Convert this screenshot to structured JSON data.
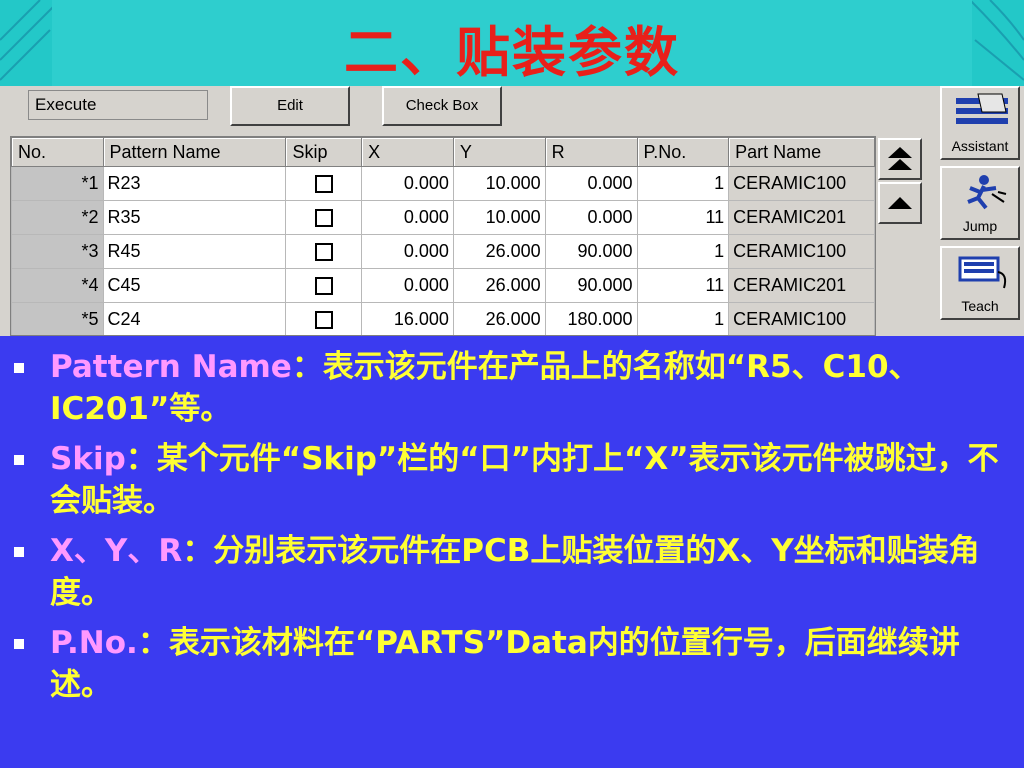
{
  "slide_title": "二、贴装参数",
  "toolbar": {
    "execute_label": "Execute",
    "edit_label": "Edit",
    "check_box_label": "Check Box"
  },
  "table": {
    "columns": [
      "No.",
      "Pattern Name",
      "Skip",
      "X",
      "Y",
      "R",
      "P.No.",
      "Part Name"
    ],
    "rows": [
      {
        "no": "*1",
        "pattern": "R23",
        "x": "0.000",
        "y": "10.000",
        "r": "0.000",
        "pno": "1",
        "part": "CERAMIC100"
      },
      {
        "no": "*2",
        "pattern": "R35",
        "x": "0.000",
        "y": "10.000",
        "r": "0.000",
        "pno": "11",
        "part": "CERAMIC201"
      },
      {
        "no": "*3",
        "pattern": "R45",
        "x": "0.000",
        "y": "26.000",
        "r": "90.000",
        "pno": "1",
        "part": "CERAMIC100"
      },
      {
        "no": "*4",
        "pattern": "C45",
        "x": "0.000",
        "y": "26.000",
        "r": "90.000",
        "pno": "11",
        "part": "CERAMIC201"
      },
      {
        "no": "*5",
        "pattern": "C24",
        "x": "16.000",
        "y": "26.000",
        "r": "180.000",
        "pno": "1",
        "part": "CERAMIC100"
      }
    ]
  },
  "side_buttons": {
    "assistant": "Assistant",
    "jump": "Jump",
    "teach": "Teach"
  },
  "notes": {
    "b1_key": "Pattern Name",
    "b1_text": "：表示该元件在产品上的名称如“R5、C10、IC201”等。",
    "b2_key": "Skip",
    "b2_text": "：某个元件“Skip”栏的“口”内打上“X”表示该元件被跳过，不会贴装。",
    "b3_key": "X、Y、R",
    "b3_text": "：分别表示该元件在PCB上贴装位置的X、Y坐标和贴装角度。",
    "b4_key": "P.No.",
    "b4_text": "：表示该材料在“PARTS”Data内的位置行号，后面继续讲述。"
  },
  "colors": {
    "title_red": "#e8201a",
    "panel_blue": "#3b3bf0",
    "text_yellow": "#ffff33",
    "key_pink": "#ff99ff",
    "background_teal": "#23c8c8"
  }
}
